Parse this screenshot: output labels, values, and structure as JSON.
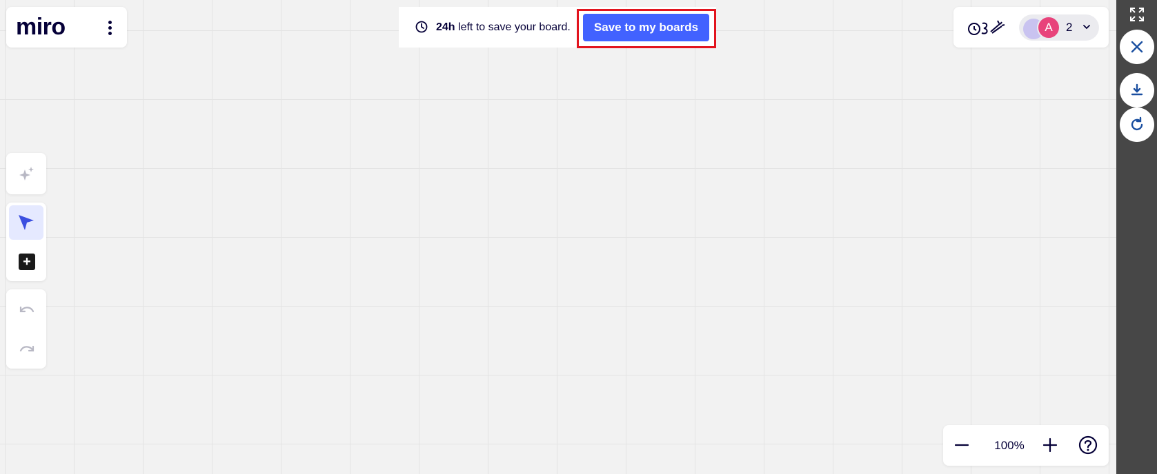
{
  "logo": {
    "text": "miro"
  },
  "save_bar": {
    "time_left": "24h",
    "message": "left to save your board.",
    "save_button_label": "Save to my boards"
  },
  "collaborators": {
    "avatar_initial": "A",
    "count": "2"
  },
  "zoom": {
    "level": "100%"
  },
  "colors": {
    "accent": "#4262ff",
    "highlight_border": "#e2141e",
    "avatar": "#e8437b",
    "sidebar": "#474747"
  },
  "icons": [
    "clock-icon",
    "more-options-icon",
    "reactions-icon",
    "chevron-down-icon",
    "fullscreen-icon",
    "close-icon",
    "download-icon",
    "refresh-icon",
    "ai-sparkle-icon",
    "select-cursor-icon",
    "add-icon",
    "undo-icon",
    "redo-icon",
    "zoom-out-icon",
    "zoom-in-icon",
    "help-icon"
  ]
}
